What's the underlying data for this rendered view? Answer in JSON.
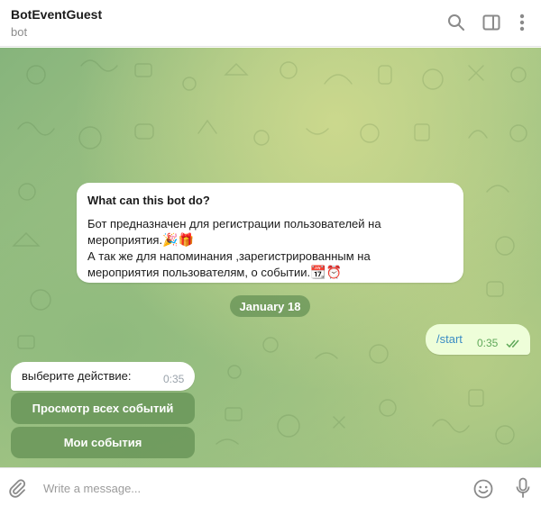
{
  "header": {
    "title": "BotEventGuest",
    "subtitle": "bot",
    "icons": [
      "search-icon",
      "sidebar-panel-icon",
      "more-vertical-icon"
    ]
  },
  "intro_card": {
    "title": "What can this bot do?",
    "line1": "Бот предназначен для регистрации пользователей на",
    "line2": "мероприятия.",
    "line3": "А так же для напоминания ,зарегистрированным на",
    "line4": "мероприятия пользователям, о событии.",
    "emoji_line2": [
      "party-popper",
      "gift"
    ],
    "emoji_line4": [
      "calendar",
      "alarm-clock"
    ]
  },
  "date_separator": "January 18",
  "outgoing_message": {
    "text": "/start",
    "time": "0:35",
    "status_icon": "double-check-icon"
  },
  "incoming_message": {
    "text": "выберите действие:",
    "time": "0:35"
  },
  "keyboard_buttons": [
    {
      "label": "Просмотр всех событий"
    },
    {
      "label": "Мои события"
    }
  ],
  "composer": {
    "placeholder": "Write a message...",
    "icons": [
      "paperclip-icon",
      "emoji-icon",
      "microphone-icon"
    ]
  },
  "colors": {
    "accent_blue": "#3a8cc4",
    "outgoing_bubble": "#eefed9",
    "outgoing_time": "#5fa859",
    "chat_background": "#a9c886",
    "keyboard_button": "#659256"
  }
}
